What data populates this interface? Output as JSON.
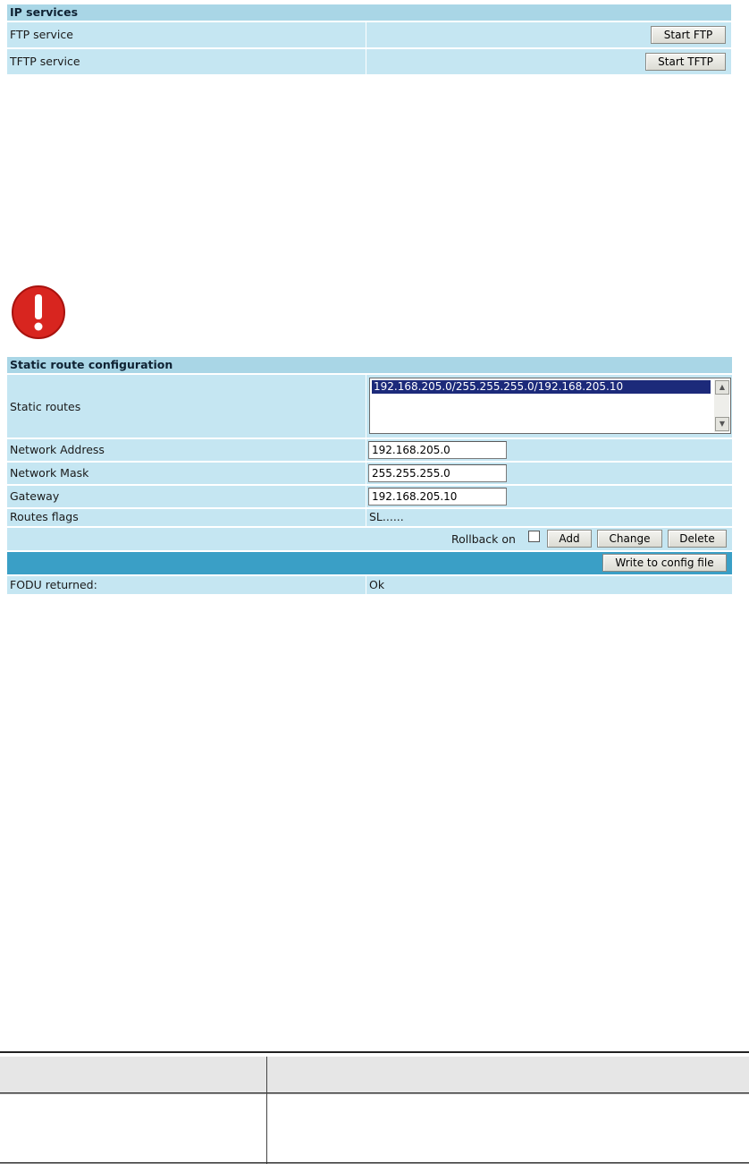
{
  "ip_services": {
    "title": "IP services",
    "rows": [
      {
        "label": "FTP service",
        "button": "Start FTP"
      },
      {
        "label": "TFTP service",
        "button": "Start TFTP"
      }
    ]
  },
  "alert": {
    "icon": "exclamation-icon"
  },
  "static_route": {
    "title": "Static route configuration",
    "static_routes_label": "Static routes",
    "static_routes_items": [
      "192.168.205.0/255.255.255.0/192.168.205.10"
    ],
    "network_address_label": "Network Address",
    "network_address_value": "192.168.205.0",
    "network_mask_label": "Network Mask",
    "network_mask_value": "255.255.255.0",
    "gateway_label": "Gateway",
    "gateway_value": "192.168.205.10",
    "routes_flags_label": "Routes flags",
    "routes_flags_value": "SL......",
    "rollback_label": "Rollback on",
    "rollback_checked": false,
    "add_button": "Add",
    "change_button": "Change",
    "delete_button": "Delete",
    "write_button": "Write to config file",
    "fodu_label": "FODU returned:",
    "fodu_value": "Ok"
  },
  "colors": {
    "panel_bg": "#c5e6f2",
    "header_bg": "#a9d6e6",
    "bar_bg": "#3a9fc6",
    "alert_red": "#d8251f"
  }
}
